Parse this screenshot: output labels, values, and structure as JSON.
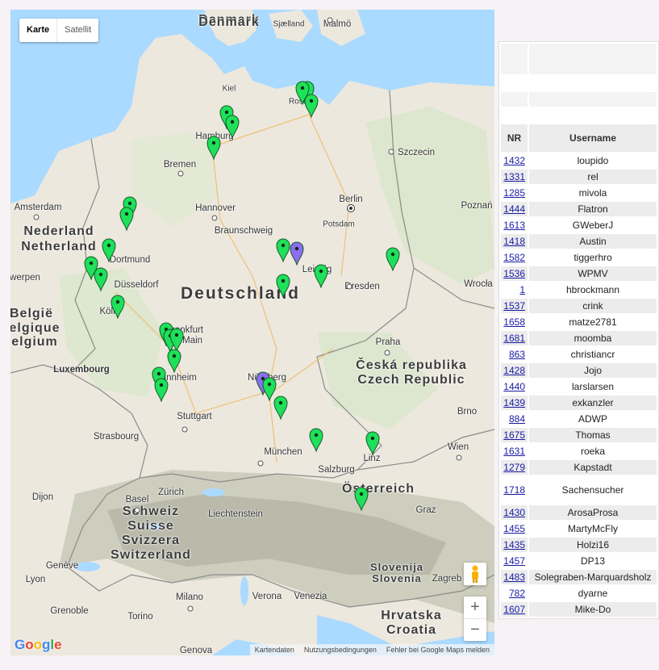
{
  "map": {
    "maptype_buttons": [
      "Karte",
      "Satellit"
    ],
    "labels": {
      "danmark": "Danmark",
      "denmark": "Denmark",
      "sjaelland": "Sjælland",
      "malmo": "Malmö",
      "kiel": "Kiel",
      "rostock": "Rostock",
      "hamburg": "Hamburg",
      "szczecin": "Szczecin",
      "bremen": "Bremen",
      "amsterdam": "Amsterdam",
      "hannover": "Hannover",
      "berlin": "Berlin",
      "poznan": "Poznań",
      "potsdam": "Potsdam",
      "braunschweig": "Braunschweig",
      "nederland": "Nederland",
      "netherland": "Netherland",
      "dortmund": "Dortmund",
      "duesseldorf": "Düsseldorf",
      "leipzig": "Leipzig",
      "dresden": "Dresden",
      "wroclaw": "Wrocła",
      "deutschland": "Deutschland",
      "belgie": "België",
      "belgique": "elgique",
      "belgium": "elgium",
      "werpen": "werpen",
      "koeln": "Köln",
      "frankfurt": "Frankfurt am Main",
      "praha": "Praha",
      "czech1": "Česká republika",
      "czech2": "Czech Republic",
      "luxembourg": "Luxembourg",
      "mannheim": "Mannheim",
      "nuernberg": "Nürnberg",
      "stuttgart": "Stuttgart",
      "brno": "Brno",
      "strasbourg": "Strasbourg",
      "muenchen": "München",
      "wien": "Wien",
      "linz": "Linz",
      "salzburg": "Salzburg",
      "basel": "Basel",
      "zuerich": "Zürich",
      "oesterreich": "Österreich",
      "dijon": "Dijon",
      "schweiz": "Schweiz",
      "suisse": "Suisse",
      "svizzera": "Svizzera",
      "switzerland": "Switzerland",
      "liechtenstein": "Liechtenstein",
      "graz": "Graz",
      "geneve": "Genève",
      "lyon": "Lyon",
      "slovenija": "Slovenija",
      "slovenia": "Slovenia",
      "zagreb": "Zagreb",
      "milano": "Milano",
      "verona": "Verona",
      "venezia": "Venezia",
      "grenoble": "Grenoble",
      "torino": "Torino",
      "hrvatska": "Hrvatska",
      "croatia": "Croatia",
      "genova": "Genova"
    },
    "zoom_in": "+",
    "zoom_out": "−",
    "google_logo": "Google",
    "attribution": [
      "Kartendaten",
      "Nutzungsbedingungen",
      "Fehler bei Google Maps melden"
    ],
    "marker_colors": {
      "green": "#1fe05a",
      "purple": "#8e6cf0"
    }
  },
  "table": {
    "headers": {
      "nr": "NR",
      "username": "Username"
    },
    "rows": [
      {
        "nr": "1432",
        "user": "loupido"
      },
      {
        "nr": "1331",
        "user": "rel"
      },
      {
        "nr": "1285",
        "user": "mivola"
      },
      {
        "nr": "1444",
        "user": "Flatron"
      },
      {
        "nr": "1613",
        "user": "GWeberJ"
      },
      {
        "nr": "1418",
        "user": "Austin"
      },
      {
        "nr": "1582",
        "user": "tiggerhro"
      },
      {
        "nr": "1536",
        "user": "WPMV"
      },
      {
        "nr": "1",
        "user": "hbrockmann"
      },
      {
        "nr": "1537",
        "user": "crink"
      },
      {
        "nr": "1658",
        "user": "matze2781"
      },
      {
        "nr": "1681",
        "user": "moomba"
      },
      {
        "nr": "863",
        "user": "christiancr"
      },
      {
        "nr": "1428",
        "user": "Jojo"
      },
      {
        "nr": "1440",
        "user": "larslarsen"
      },
      {
        "nr": "1439",
        "user": "exkanzler"
      },
      {
        "nr": "884",
        "user": "ADWP"
      },
      {
        "nr": "1675",
        "user": "Thomas"
      },
      {
        "nr": "1631",
        "user": "roeka"
      },
      {
        "nr": "1279",
        "user": "Kapstadt"
      },
      {
        "nr": "1718",
        "user": "Sachensucher"
      },
      {
        "nr": "1430",
        "user": "ArosaProsa"
      },
      {
        "nr": "1455",
        "user": "MartyMcFly"
      },
      {
        "nr": "1435",
        "user": "Holzi16"
      },
      {
        "nr": "1457",
        "user": "DP13"
      },
      {
        "nr": "1483",
        "user": "Solegraben-Marquardsholz"
      },
      {
        "nr": "782",
        "user": "dyarne"
      },
      {
        "nr": "1607",
        "user": "Mike-Do"
      }
    ]
  }
}
